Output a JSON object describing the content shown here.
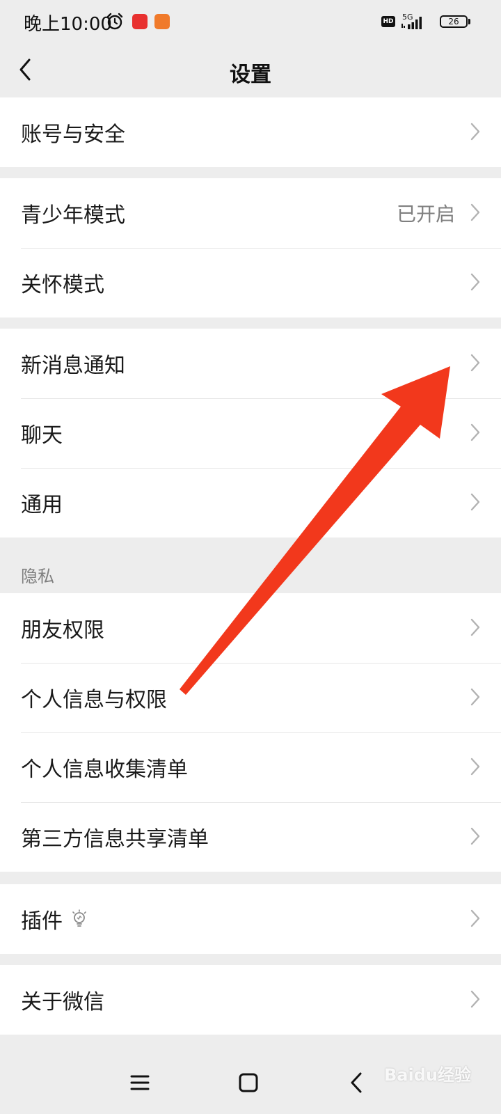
{
  "status_bar": {
    "time": "晚上10:00",
    "network": "5G",
    "hd_badge": "HD",
    "battery": "26",
    "icons": [
      "alarm-icon",
      "app-icon",
      "app-icon",
      "signal-icon"
    ]
  },
  "nav": {
    "title": "设置",
    "back_icon": "chevron-left-icon"
  },
  "groups": [
    {
      "rows": [
        {
          "label": "账号与安全"
        }
      ]
    },
    {
      "rows": [
        {
          "label": "青少年模式",
          "value": "已开启"
        },
        {
          "label": "关怀模式"
        }
      ]
    },
    {
      "rows": [
        {
          "label": "新消息通知"
        },
        {
          "label": "聊天"
        },
        {
          "label": "通用"
        }
      ]
    },
    {
      "section_title": "隐私",
      "rows": [
        {
          "label": "朋友权限"
        },
        {
          "label": "个人信息与权限"
        },
        {
          "label": "个人信息收集清单"
        },
        {
          "label": "第三方信息共享清单"
        }
      ]
    },
    {
      "rows": [
        {
          "label": "插件",
          "icon": "lightbulb-icon"
        }
      ]
    },
    {
      "rows": [
        {
          "label": "关于微信"
        }
      ]
    }
  ],
  "system_nav": {
    "icons": [
      "menu-icon",
      "home-icon",
      "back-icon"
    ]
  },
  "watermark": "Baidu经验",
  "annotation": {
    "color": "#f2381c"
  }
}
